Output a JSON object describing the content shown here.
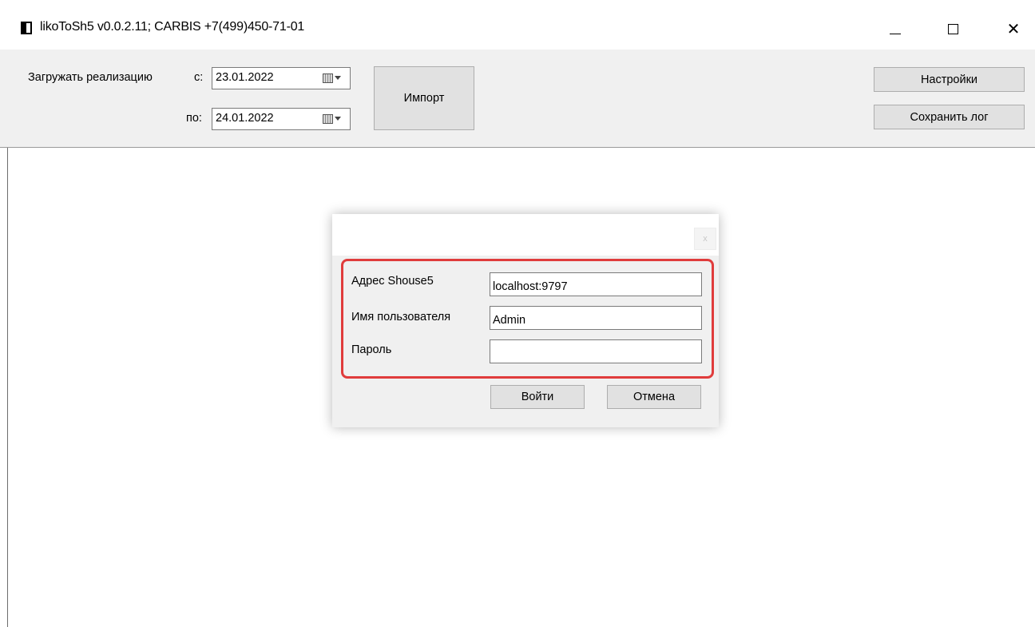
{
  "window": {
    "title": "likoToSh5 v0.0.2.11;  CARBIS +7(499)450-71-01",
    "close_glyph": "✕"
  },
  "toolbar": {
    "load_label": "Загружать реализацию",
    "from_label": "с:",
    "from_date": "23.01.2022",
    "to_label": "по:",
    "to_date": "24.01.2022",
    "import_button": "Импорт",
    "settings_button": "Настройки",
    "save_log_button": "Сохранить лог"
  },
  "dialog": {
    "close_glyph": "x",
    "fields": {
      "address_label": "Адрес Shouse5",
      "address_value": "localhost:9797",
      "username_label": "Имя пользователя",
      "username_value": "Admin",
      "password_label": "Пароль",
      "password_value": ""
    },
    "login_button": "Войти",
    "cancel_button": "Отмена"
  },
  "colors": {
    "highlight": "#e03c3c",
    "panel_bg": "#f0f0f0",
    "button_bg": "#e1e1e1"
  },
  "icons": [
    "app-icon",
    "minimize-icon",
    "maximize-icon",
    "close-icon",
    "calendar-icon",
    "dropdown-arrow-icon"
  ]
}
